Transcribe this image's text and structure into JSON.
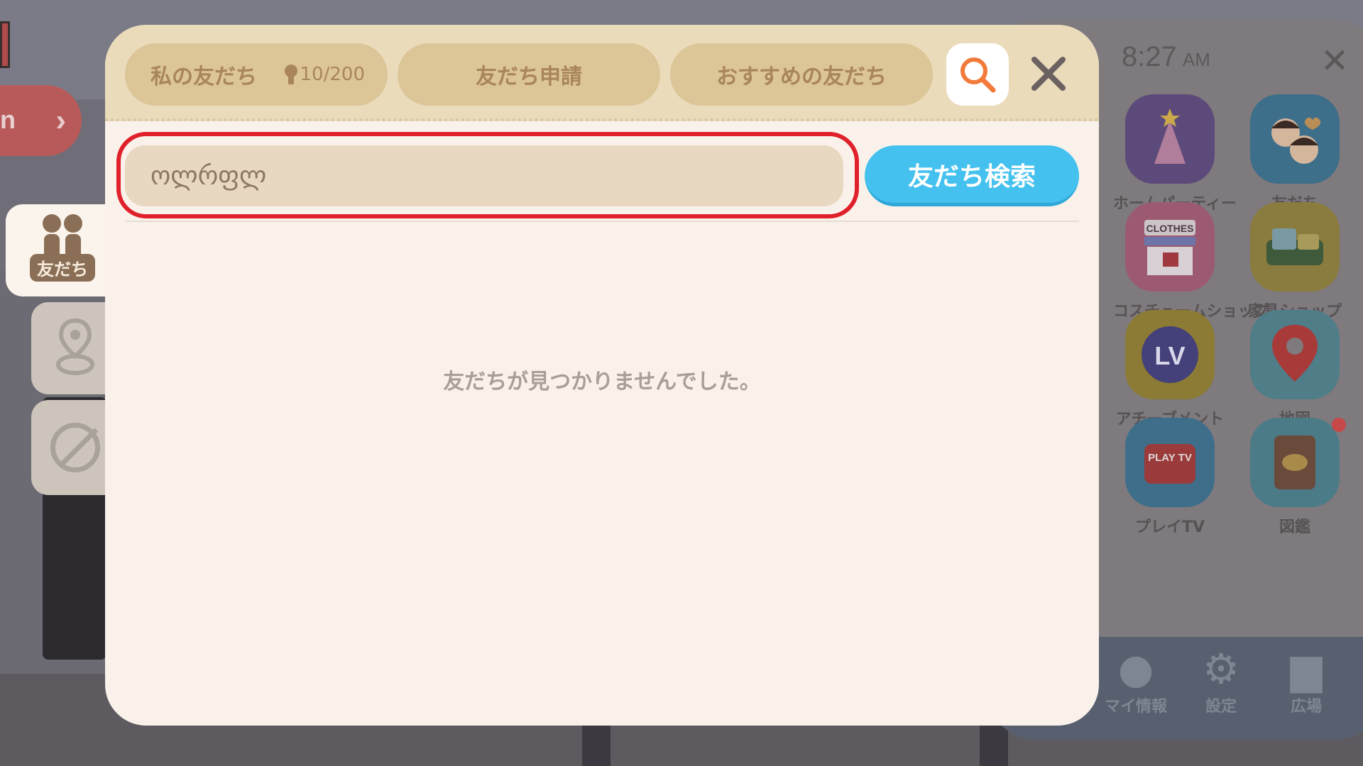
{
  "background": {
    "side_button_text": "n"
  },
  "side_menu": {
    "time": "8:27",
    "ampm": "AM",
    "apps": [
      {
        "label": "ホームパーティー",
        "icon": "party-hat-icon"
      },
      {
        "label": "友だち",
        "icon": "friends-faces-icon"
      },
      {
        "label": "コスチュームショップ",
        "icon": "clothes-shop-icon",
        "sign": "CLOTHES"
      },
      {
        "label": "家具ショップ",
        "icon": "sofa-icon"
      },
      {
        "label": "アチーブメント",
        "icon": "level-badge-icon",
        "sign": "LV"
      },
      {
        "label": "地図",
        "icon": "map-pin-icon"
      },
      {
        "label": "プレイTV",
        "icon": "play-tv-icon",
        "sign": "PLAY TV"
      },
      {
        "label": "図鑑",
        "icon": "fish-book-icon"
      }
    ],
    "dock": [
      {
        "label": "マイ情報",
        "icon": "person-icon"
      },
      {
        "label": "設定",
        "icon": "gear-icon"
      },
      {
        "label": "広場",
        "icon": "city-icon"
      }
    ]
  },
  "left_tabs": {
    "friends_label": "友だち"
  },
  "dialog": {
    "tabs": {
      "my_friends": "私の友だち",
      "friend_count": "10/200",
      "requests": "友だち申請",
      "recommended": "おすすめの友だち"
    },
    "search": {
      "input_value": "ოლრფლ",
      "button_label": "友だち検索"
    },
    "empty_message": "友だちが見つかりませんでした。"
  },
  "colors": {
    "header_bg": "#eadbbb",
    "tab_bg": "#dcc596",
    "tab_text": "#a9865a",
    "panel_bg": "#faf2ea",
    "search_button": "#44c1ef",
    "highlight": "#e0202a"
  }
}
